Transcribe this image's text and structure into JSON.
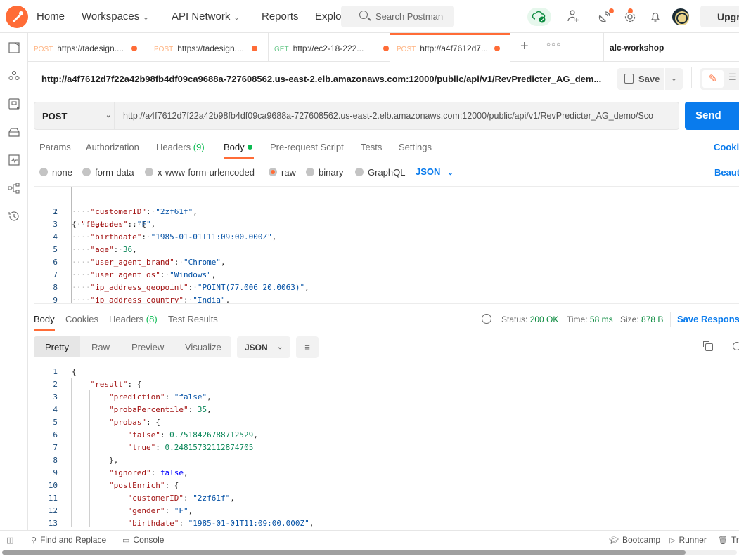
{
  "app": "Postman",
  "nav": {
    "home": "Home",
    "workspaces": "Workspaces",
    "api_network": "API Network",
    "reports": "Reports",
    "explore": "Explo",
    "search_placeholder": "Search Postman",
    "upgrade": "Upgra"
  },
  "tabs": [
    {
      "method": "POST",
      "label": "https://tadesign....",
      "unsaved": true
    },
    {
      "method": "POST",
      "label": "https://tadesign....",
      "unsaved": true
    },
    {
      "method": "GET",
      "label": "http://ec2-18-222...",
      "unsaved": true
    },
    {
      "method": "POST",
      "label": "http://a4f7612d7...",
      "unsaved": true,
      "active": true
    }
  ],
  "environment": "alc-workshop",
  "request": {
    "title": "http://a4f7612d7f22a42b98fb4df09ca9688a-727608562.us-east-2.elb.amazonaws.com:12000/public/api/v1/RevPredicter_AG_dem...",
    "save": "Save",
    "method": "POST",
    "url": "http://a4f7612d7f22a42b98fb4df09ca9688a-727608562.us-east-2.elb.amazonaws.com:12000/public/api/v1/RevPredicter_AG_demo/Sco",
    "send": "Send",
    "tabs": {
      "params": "Params",
      "authorization": "Authorization",
      "headers": "Headers",
      "headers_count": "(9)",
      "body": "Body",
      "prerequest": "Pre-request Script",
      "tests": "Tests",
      "settings": "Settings",
      "cookies": "Cookie"
    },
    "body_types": {
      "none": "none",
      "form_data": "form-data",
      "urlencoded": "x-www-form-urlencoded",
      "raw": "raw",
      "binary": "binary",
      "graphql": "GraphQL",
      "format": "JSON",
      "beautify": "Beauti"
    },
    "body_lines": [
      {
        "n": "1"
      },
      {
        "n": "2",
        "key": "\"customerID\"",
        "val": "\"2zf61f\""
      },
      {
        "n": "3",
        "key": "\"gender\"",
        "val": "\"F\""
      },
      {
        "n": "4",
        "key": "\"birthdate\"",
        "val": "\"1985-01-01T11:09:00.000Z\""
      },
      {
        "n": "5",
        "key": "\"age\"",
        "val": "36"
      },
      {
        "n": "6",
        "key": "\"user_agent_brand\"",
        "val": "\"Chrome\""
      },
      {
        "n": "7",
        "key": "\"user_agent_os\"",
        "val": "\"Windows\""
      },
      {
        "n": "8",
        "key": "\"ip_address_geopoint\"",
        "val": "\"POINT(77.006 20.0063)\""
      },
      {
        "n": "9",
        "key": "\"ip_address_country\"",
        "val": "\"India\""
      }
    ],
    "body_first_key": "\"features\""
  },
  "response": {
    "tabs": {
      "body": "Body",
      "cookies": "Cookies",
      "headers": "Headers",
      "headers_count": "(8)",
      "test_results": "Test Results"
    },
    "status_label": "Status:",
    "status": "200 OK",
    "time_label": "Time:",
    "time": "58 ms",
    "size_label": "Size:",
    "size": "878 B",
    "save_response": "Save Response",
    "views": {
      "pretty": "Pretty",
      "raw": "Raw",
      "preview": "Preview",
      "visualize": "Visualize"
    },
    "format": "JSON",
    "lines": [
      {
        "n": "1",
        "text": "{"
      },
      {
        "n": "2",
        "key": "\"result\"",
        "val": "{"
      },
      {
        "n": "3",
        "key": "\"prediction\"",
        "val": "\"false\""
      },
      {
        "n": "4",
        "key": "\"probaPercentile\"",
        "val": "35"
      },
      {
        "n": "5",
        "key": "\"probas\"",
        "val": "{"
      },
      {
        "n": "6",
        "key": "\"false\"",
        "val": "0.7518426788712529"
      },
      {
        "n": "7",
        "key": "\"true\"",
        "val": "0.24815732112874705"
      },
      {
        "n": "8",
        "text": "},"
      },
      {
        "n": "9",
        "key": "\"ignored\"",
        "val": "false"
      },
      {
        "n": "10",
        "key": "\"postEnrich\"",
        "val": "{"
      },
      {
        "n": "11",
        "key": "\"customerID\"",
        "val": "\"2zf61f\""
      },
      {
        "n": "12",
        "key": "\"gender\"",
        "val": "\"F\""
      },
      {
        "n": "13",
        "key": "\"birthdate\"",
        "val": "\"1985-01-01T11:09:00.000Z\""
      }
    ]
  },
  "footer": {
    "find_replace": "Find and Replace",
    "console": "Console",
    "bootcamp": "Bootcamp",
    "runner": "Runner",
    "trash": "Tra"
  },
  "colors": {
    "accent": "#ff6c37",
    "primary": "#097bed",
    "success": "#0cbb52"
  }
}
